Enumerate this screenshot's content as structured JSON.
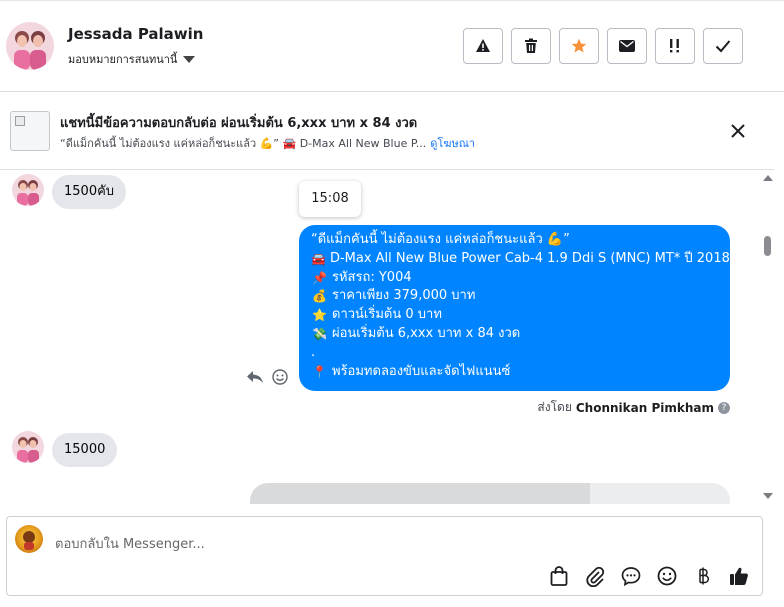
{
  "header": {
    "name": "Jessada Palawin",
    "assign_label": "มอบหมายการสนทนานี้",
    "tools": [
      {
        "name": "spam-icon",
        "label": "Mark as spam"
      },
      {
        "name": "trash-icon",
        "label": "Delete"
      },
      {
        "name": "star-icon",
        "label": "Star"
      },
      {
        "name": "mail-icon",
        "label": "Mark unread"
      },
      {
        "name": "follow-up-icon",
        "label": "Follow up"
      },
      {
        "name": "check-icon",
        "label": "Done"
      }
    ],
    "star_color": "#f7923a"
  },
  "context": {
    "title": "แชทนี้มีข้อความตอบกลับต่อ ผ่อนเริ่มต้น 6,xxx บาท x 84 งวด",
    "subtitle": "“ดีแม็กคันนี้ ไม่ต้องแรง แค่หล่อก็ชนะแล้ว 💪” 🚘 D-Max All New Blue P...",
    "link": "ดูโฆษณา"
  },
  "messages": {
    "incoming_1": "1500คับ",
    "time": "15:08",
    "outgoing": {
      "color": "#0084ff",
      "lines": [
        {
          "emoji": "",
          "text": "“ดีแม็กคันนี้ ไม่ต้องแรง แค่หล่อก็ชนะแล้ว 💪”"
        },
        {
          "emoji": "🚘",
          "text": "D-Max All New Blue Power Cab-4 1.9 Ddi S (MNC) MT* ปี 2018"
        },
        {
          "emoji": "📌",
          "text": "รหัสรถ: Y004"
        },
        {
          "emoji": "💰",
          "text": "ราคาเพียง 379,000 บาท"
        },
        {
          "emoji": "⭐",
          "text": "ดาวน์เริ่มต้น 0 บาท"
        },
        {
          "emoji": "💸",
          "text": "ผ่อนเริ่มต้น 6,xxx บาท x 84 งวด"
        },
        {
          "emoji": "",
          "text": "."
        },
        {
          "emoji": "📍",
          "text": "พร้อมทดลองขับและจัดไฟแนนซ์"
        }
      ]
    },
    "sent_by_label": "ส่งโดย",
    "sent_by_name": "Chonnikan Pimkham",
    "incoming_2": "15000"
  },
  "composer": {
    "placeholder": "ตอบกลับใน Messenger...",
    "tools": [
      "bag-icon",
      "attach-icon",
      "saved-reply-icon",
      "emoji-icon",
      "baht-icon",
      "thumbs-up-icon"
    ]
  }
}
